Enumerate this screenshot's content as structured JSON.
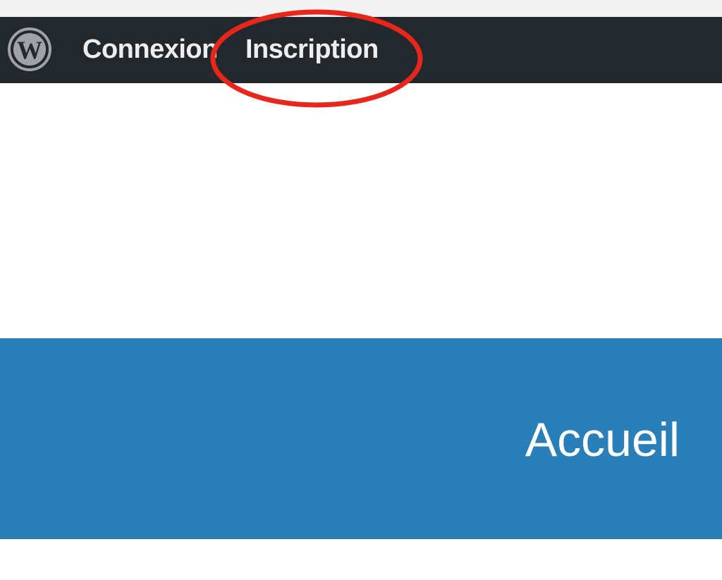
{
  "admin_bar": {
    "logo_icon": "wordpress-icon",
    "links": {
      "login": "Connexion",
      "register": "Inscription"
    }
  },
  "annotation": {
    "shape": "ellipse",
    "color": "#e8261c",
    "target": "register"
  },
  "navigation": {
    "home_label": "Accueil",
    "background_color": "#2a7fb8"
  }
}
